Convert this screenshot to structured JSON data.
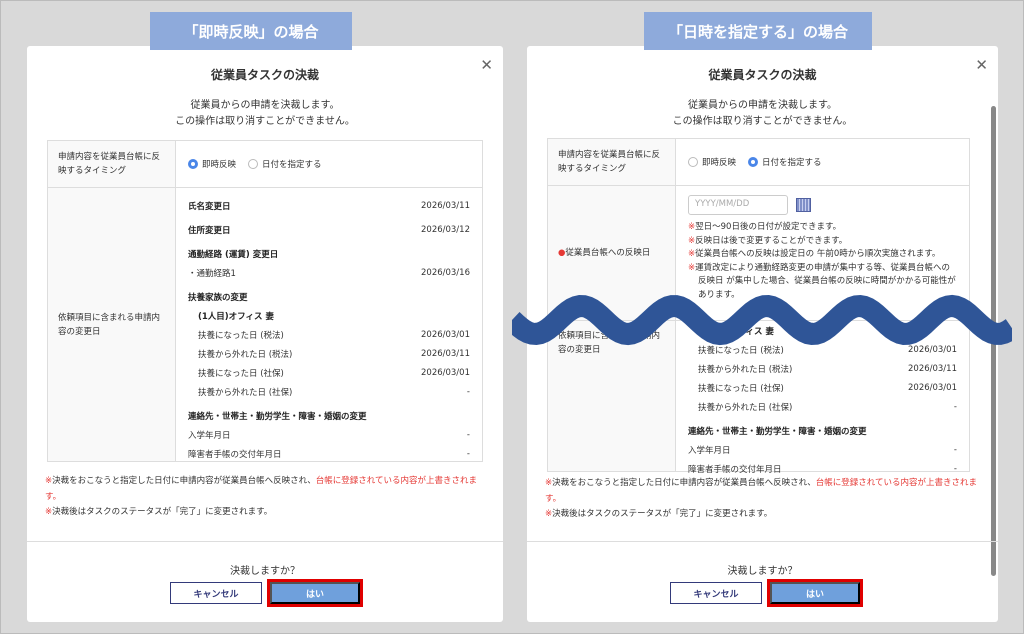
{
  "labels": {
    "left": "「即時反映」の場合",
    "right": "「日時を指定する」の場合"
  },
  "dialog": {
    "title": "従業員タスクの決裁",
    "sub1": "従業員からの申請を決裁します。",
    "sub2": "この操作は取り消すことができません。",
    "timing_label": "申請内容を従業員台帳に反映するタイミング",
    "radio_now": "即時反映",
    "radio_date": "日付を指定する",
    "changes_label": "依頼項目に含まれる申請内容の変更日",
    "reflect_label": "従業員台帳への反映日",
    "date_placeholder": "YYYY/MM/DD",
    "date_notes": [
      "翌日〜90日後の日付が設定できます。",
      "反映日は後で変更することができます。",
      "従業員台帳への反映は設定日の 午前0時から順次実施されます。",
      "運賃改定により通勤経路変更の申請が集中する等、従業員台帳への反映日 が集中した場合、従業員台帳の反映に時間がかかる可能性があります。"
    ],
    "mark": "※",
    "items": [
      {
        "label": "氏名変更日",
        "value": "2026/03/11",
        "kind": "b"
      },
      {
        "label": "住所変更日",
        "value": "2026/03/12",
        "kind": "b"
      },
      {
        "label": "通勤経路 (運賃) 変更日",
        "value": "",
        "kind": "b"
      },
      {
        "label": "・通勤経路1",
        "value": "2026/03/16",
        "kind": "n"
      },
      {
        "label": "扶養家族の変更",
        "value": "",
        "kind": "b"
      },
      {
        "label": "(1人目)オフィス 妻",
        "value": "",
        "kind": "bi"
      },
      {
        "label": "扶養になった日 (税法)",
        "value": "2026/03/01",
        "kind": "i"
      },
      {
        "label": "扶養から外れた日 (税法)",
        "value": "2026/03/11",
        "kind": "i"
      },
      {
        "label": "扶養になった日 (社保)",
        "value": "2026/03/01",
        "kind": "i"
      },
      {
        "label": "扶養から外れた日 (社保)",
        "value": "-",
        "kind": "i"
      },
      {
        "label": "連絡先・世帯主・勤労学生・障害・婚姻の変更",
        "value": "",
        "kind": "b"
      },
      {
        "label": "入学年月日",
        "value": "-",
        "kind": "n"
      },
      {
        "label": "障害者手帳の交付年月日",
        "value": "-",
        "kind": "n"
      }
    ],
    "note1a": "決裁をおこなうと指定した日付に申請内容が従業員台帳へ反映され、",
    "note1b": "台帳に登録されている内容が上書きされます。",
    "note2": "決裁後はタスクのステータスが「完了」に変更されます。",
    "ask": "決裁しますか？",
    "cancel": "キャンセル",
    "yes": "はい"
  },
  "colors": {
    "accent": "#4a86e8",
    "highlight": "#e00000",
    "wave": "#2f5597",
    "tag": "#8eaadb"
  }
}
